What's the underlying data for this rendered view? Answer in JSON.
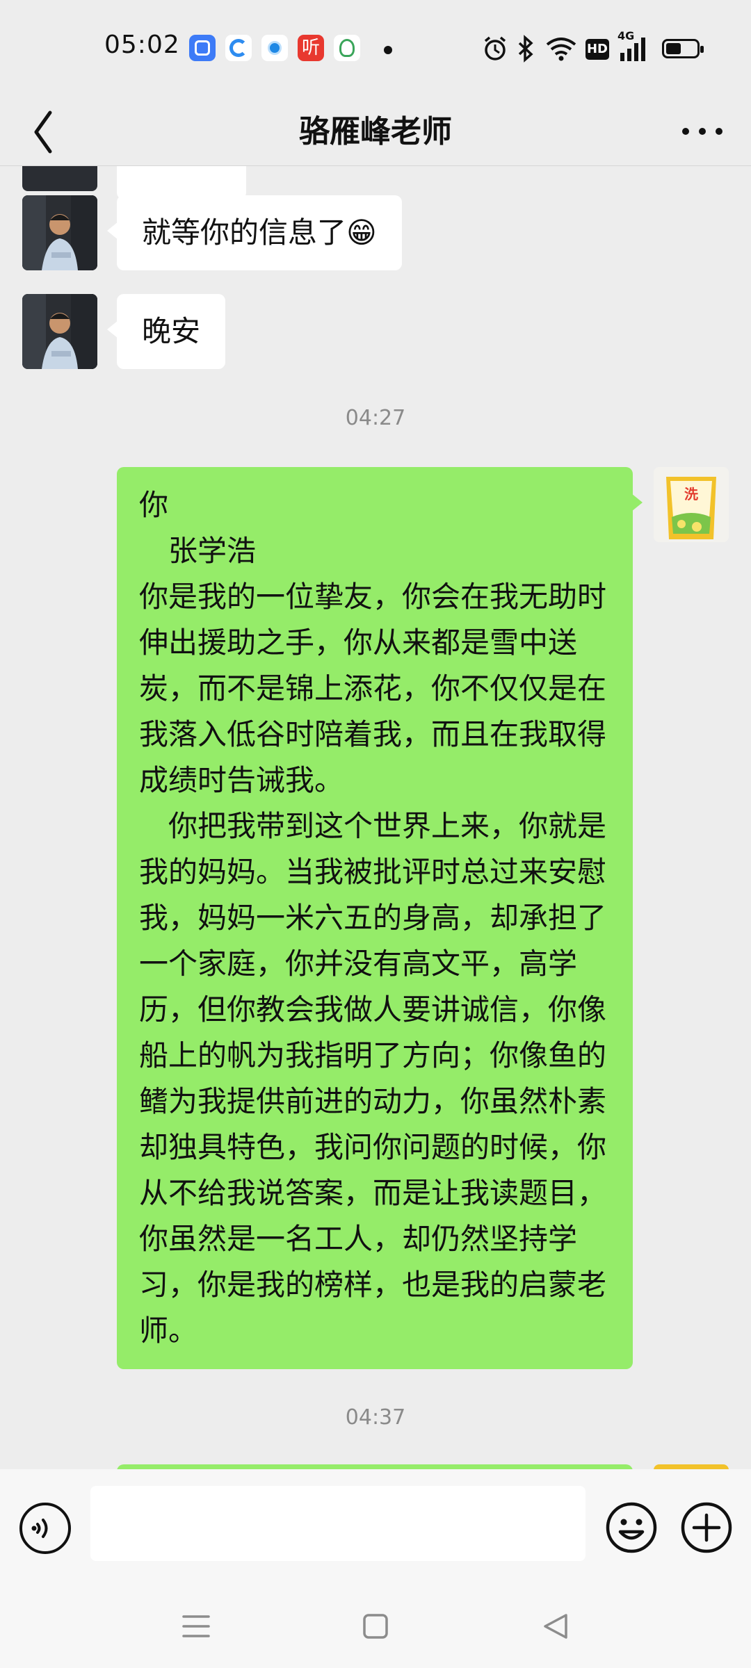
{
  "status_bar": {
    "time": "05:02",
    "notification_icons": [
      "app-icon-blue-square",
      "app-icon-browser",
      "app-icon-blue-circle",
      "app-icon-listen",
      "app-icon-green"
    ],
    "listen_app_glyph": "听",
    "right_icons": [
      "alarm-icon",
      "bluetooth-icon",
      "wifi-icon",
      "hd-icon",
      "signal-4g-icon",
      "battery-icon"
    ],
    "hd_label": "HD",
    "network_label": "4G",
    "battery_level": 0.5
  },
  "header": {
    "title": "骆雁峰老师",
    "back_icon": "chevron-left-icon",
    "more_icon": "more-dots-icon"
  },
  "messages": {
    "incoming_1": "就等你的信息了😁",
    "incoming_2": "晚安",
    "timestamp_1": "04:27",
    "outgoing_1": {
      "line_1": "你",
      "line_2": "　张学浩",
      "paragraph_1": "你是我的一位挚友，你会在我无助时伸出援助之手，你从来都是雪中送炭，而不是锦上添花，你不仅仅是在我落入低谷时陪着我，而且在我取得成绩时告诫我。",
      "paragraph_2": "　你把我带到这个世界上来，你就是我的妈妈。当我被批评时总过来安慰我，妈妈一米六五的身高，却承担了一个家庭，你并没有高文平，高学历，但你教会我做人要讲诚信，你像船上的帆为我指明了方向；你像鱼的鳍为我提供前进的动力，你虽然朴素却独具特色，我问你问题的时候，你从不给我说答案，而是让我读题目，你虽然是一名工人，却仍然坚持学习，你是我的榜样，也是我的启蒙老师。"
    },
    "timestamp_2": "04:37"
  },
  "input_bar": {
    "voice_icon": "voice-input-icon",
    "text_value": "",
    "emoji_icon": "emoji-icon",
    "plus_icon": "plus-circle-icon"
  },
  "nav_bar": {
    "icons": [
      "menu-icon",
      "home-icon",
      "back-triangle-icon"
    ]
  },
  "colors": {
    "background": "#ededed",
    "outgoing_bubble": "#95ec69",
    "incoming_bubble": "#ffffff",
    "timestamp": "#8a8a8a"
  }
}
